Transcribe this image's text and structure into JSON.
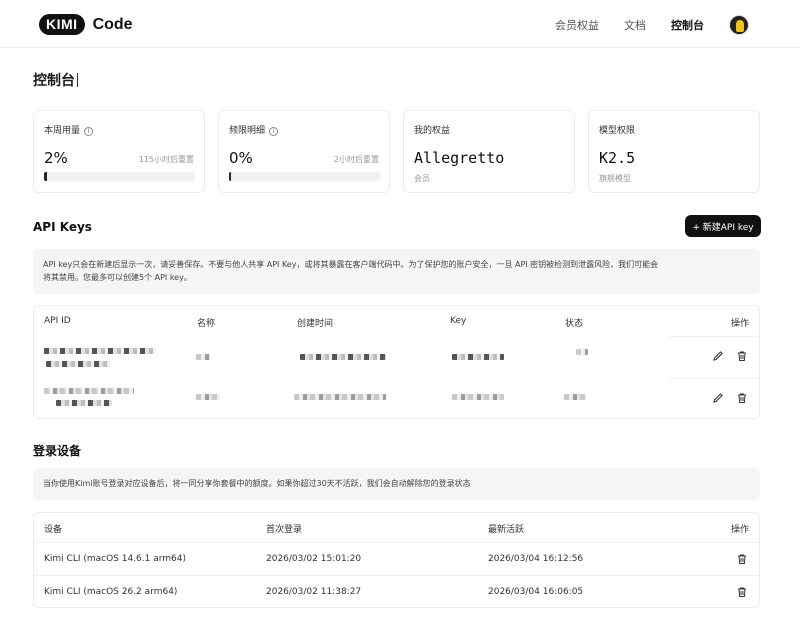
{
  "header": {
    "logo_badge": "KIMI",
    "logo_text": "Code",
    "nav": [
      "会员权益",
      "文档",
      "控制台"
    ]
  },
  "page_title": "控制台",
  "cards": [
    {
      "title": "本周用量",
      "value": "2%",
      "reset": "115小时后重置",
      "progress": 0.02
    },
    {
      "title": "频限明细",
      "value": "0%",
      "reset": "2小时后重置",
      "progress": 0.0
    },
    {
      "title": "我的权益",
      "value": "Allegretto",
      "sub": "会员"
    },
    {
      "title": "模型权限",
      "value": "K2.5",
      "sub": "旗舰模型"
    }
  ],
  "api_keys": {
    "title": "API Keys",
    "new_button": "+ 新建API key",
    "notice_line1": "API key只会在新建后显示一次，请妥善保存。不要与他人共享 API Key，或将其暴露在客户端代码中。为了保护您的账户安全，一旦 API 密钥被检测到泄露风险，我们可能会",
    "notice_line2": "将其禁用。您最多可以创建5个 API key。",
    "columns": [
      "API ID",
      "名称",
      "创建时间",
      "Key",
      "状态",
      "操作"
    ]
  },
  "devices": {
    "title": "登录设备",
    "notice": "当你使用Kimi账号登录对应设备后，将一同分享你套餐中的额度。如果你超过30天不活跃，我们会自动解除您的登录状态",
    "columns": [
      "设备",
      "首次登录",
      "最新活跃",
      "操作"
    ],
    "rows": [
      {
        "device": "Kimi CLI (macOS 14.6.1 arm64)",
        "first": "2026/03/02 15:01:20",
        "last": "2026/03/04 16:12:56"
      },
      {
        "device": "Kimi CLI (macOS 26.2 arm64)",
        "first": "2026/03/02 11:38:27",
        "last": "2026/03/04 16:06:05"
      }
    ]
  }
}
